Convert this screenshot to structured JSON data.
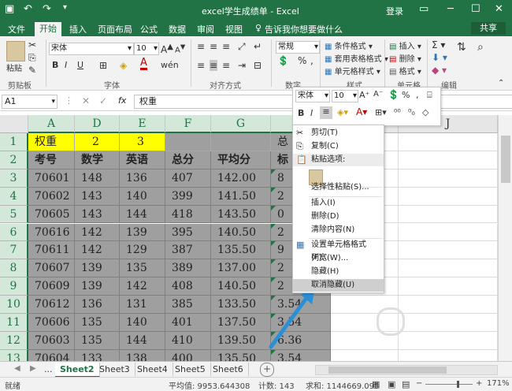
{
  "titlebar": {
    "title": "excel学生成绩单  -  Excel",
    "login": "登录",
    "minimize": "─",
    "restore": "☐",
    "close": "✕"
  },
  "tabs": [
    "文件",
    "开始",
    "插入",
    "页面布局",
    "公式",
    "数据",
    "审阅",
    "视图"
  ],
  "tell_me": "告诉我你想要做什么",
  "share": "共享",
  "ribbon": {
    "paste": "粘贴",
    "clipboard": "剪贴板",
    "font_name": "宋体",
    "font_size": "10",
    "font_group": "字体",
    "align_group": "对齐方式",
    "number_format": "常规",
    "number_group": "数字",
    "style_items": [
      "条件格式",
      "套用表格格式",
      "单元格样式"
    ],
    "style_group": "样式",
    "cell_items": [
      "插入",
      "删除",
      "格式"
    ],
    "cell_group": "单元格",
    "edit_group": "编辑"
  },
  "formula_bar": {
    "name_box": "A1",
    "fx": "fx",
    "value": "权重"
  },
  "columns": [
    "A",
    "D",
    "E",
    "F",
    "G",
    "H",
    "I",
    "J"
  ],
  "rows": [
    "1",
    "2",
    "3",
    "4",
    "5",
    "6",
    "7",
    "8",
    "9",
    "10",
    "11",
    "12",
    "13"
  ],
  "sheet": {
    "row1": [
      "权重",
      "2",
      "3",
      "",
      "",
      "总"
    ],
    "header": [
      "考号",
      "数学",
      "英语",
      "总分",
      "平均分",
      "标"
    ],
    "data": [
      [
        "70601",
        "148",
        "136",
        "407",
        "142.00",
        "8"
      ],
      [
        "70602",
        "143",
        "140",
        "399",
        "141.50",
        "2"
      ],
      [
        "70605",
        "143",
        "144",
        "418",
        "143.50",
        "0"
      ],
      [
        "70616",
        "142",
        "139",
        "395",
        "140.50",
        "2"
      ],
      [
        "70611",
        "142",
        "129",
        "387",
        "135.50",
        "9"
      ],
      [
        "70607",
        "139",
        "135",
        "389",
        "137.00",
        "2"
      ],
      [
        "70609",
        "139",
        "142",
        "408",
        "140.50",
        "2"
      ],
      [
        "70612",
        "136",
        "131",
        "385",
        "133.50",
        "3.54"
      ],
      [
        "70606",
        "135",
        "140",
        "401",
        "137.50",
        "3.54"
      ],
      [
        "70603",
        "135",
        "144",
        "410",
        "139.50",
        "6.36"
      ],
      [
        "70604",
        "133",
        "138",
        "400",
        "135.50",
        "3.54"
      ]
    ]
  },
  "mini_toolbar": {
    "font": "宋体",
    "size": "10",
    "percent": "%",
    "comma": ","
  },
  "context_menu": {
    "items": [
      "剪切(T)",
      "复制(C)",
      "粘贴选项:",
      "选择性粘贴(S)...",
      "插入(I)",
      "删除(D)",
      "清除内容(N)",
      "设置单元格格式(F)...",
      "列宽(W)...",
      "隐藏(H)",
      "取消隐藏(U)"
    ]
  },
  "sheet_tabs": [
    "...",
    "Sheet2",
    "Sheet3",
    "Sheet4",
    "Sheet5",
    "Sheet6"
  ],
  "add_sheet": "+",
  "status": {
    "ready": "就绪",
    "average": "平均值: 9953.644308",
    "count": "计数: 143",
    "sum": "求和: 1144669.095",
    "zoom": "171%"
  },
  "colors": {
    "accent": "#217346",
    "selection_gray": "#9f9f9f",
    "weight_yellow": "#ffff00",
    "arrow_blue": "#2b8fd6"
  }
}
